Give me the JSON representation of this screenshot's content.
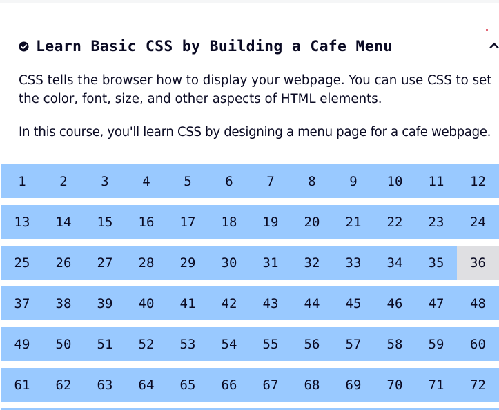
{
  "colors": {
    "accent": "#99c9ff",
    "current_step": "#dfdfe2",
    "text": "#0a0a23",
    "notification_dot": "#d0021b"
  },
  "header": {
    "title": "Learn Basic CSS by Building a Cafe Menu",
    "status_icon": "check-circle-icon",
    "toggle_icon": "chevron-up-icon"
  },
  "description": [
    "CSS tells the browser how to display your webpage. You can use CSS to set the color, font, size, and other aspects of HTML elements.",
    "In this course, you'll learn CSS by designing a menu page for a cafe webpage."
  ],
  "steps": {
    "current": "36",
    "rows": [
      [
        "1",
        "2",
        "3",
        "4",
        "5",
        "6",
        "7",
        "8",
        "9",
        "10",
        "11",
        "12"
      ],
      [
        "13",
        "14",
        "15",
        "16",
        "17",
        "18",
        "19",
        "20",
        "21",
        "22",
        "23",
        "24"
      ],
      [
        "25",
        "26",
        "27",
        "28",
        "29",
        "30",
        "31",
        "32",
        "33",
        "34",
        "35",
        "36"
      ],
      [
        "37",
        "38",
        "39",
        "40",
        "41",
        "42",
        "43",
        "44",
        "45",
        "46",
        "47",
        "48"
      ],
      [
        "49",
        "50",
        "51",
        "52",
        "53",
        "54",
        "55",
        "56",
        "57",
        "58",
        "59",
        "60"
      ],
      [
        "61",
        "62",
        "63",
        "64",
        "65",
        "66",
        "67",
        "68",
        "69",
        "70",
        "71",
        "72"
      ]
    ]
  }
}
